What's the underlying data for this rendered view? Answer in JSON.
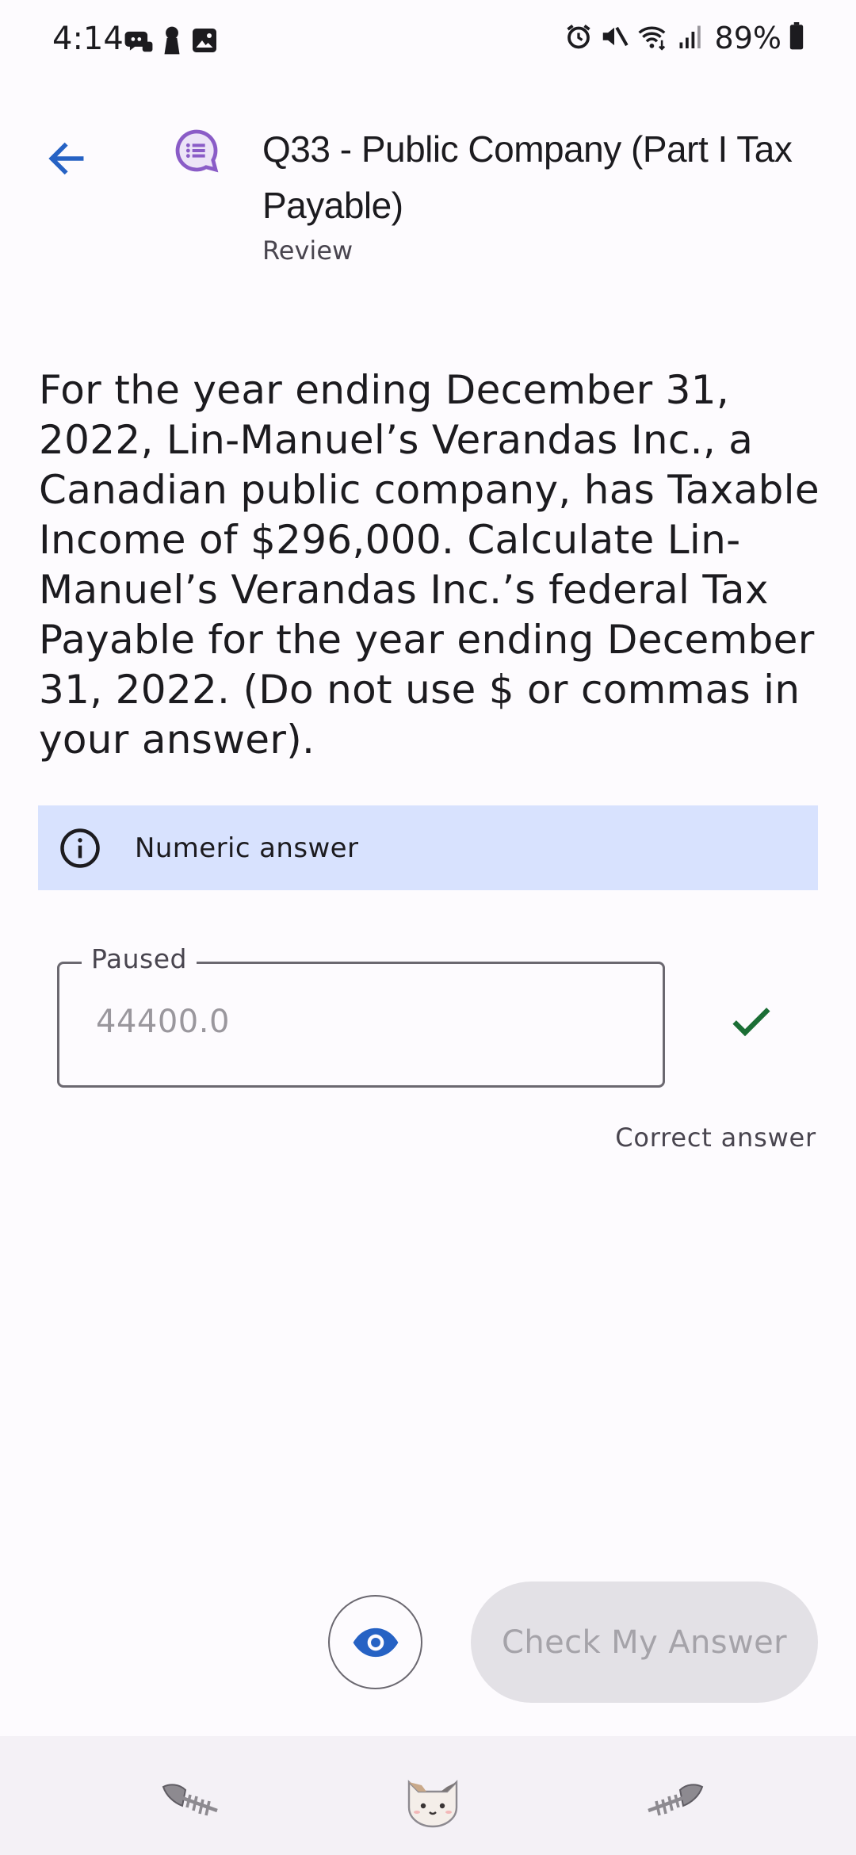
{
  "status_bar": {
    "time": "4:14",
    "battery": "89%",
    "left_icons": [
      "discord-icon",
      "keyhole-icon",
      "image-icon"
    ],
    "right_icons": [
      "alarm-icon",
      "mute-icon",
      "wifi-icon",
      "signal-icon",
      "battery-icon"
    ]
  },
  "header": {
    "title": "Q33 - Public Company (Part I Tax Payable)",
    "subtitle": "Review",
    "icon": "chat-list-icon",
    "accent": "#8a5cc7"
  },
  "question": {
    "text": "For the year ending December 31, 2022, Lin-Manuel’s Verandas Inc., a Canadian public company, has Taxable Income of $296,000. Calculate Lin-Manuel’s Verandas Inc.’s federal Tax Payable for the year ending December 31, 2022. (Do not use $ or commas in your answer)."
  },
  "info_banner": {
    "text": "Numeric answer",
    "icon": "info-icon",
    "background": "#d8e2fe"
  },
  "answer": {
    "label": "Paused",
    "placeholder": "44400.0",
    "status_text": "Correct answer",
    "status_color": "#1b6e35"
  },
  "actions": {
    "reveal_icon": "eye-icon",
    "check_label": "Check My Answer"
  },
  "bottom_nav": {
    "items": [
      "fishbone-left-icon",
      "cat-icon",
      "fishbone-right-icon"
    ]
  },
  "colors": {
    "primary_blue": "#2662c4",
    "background": "#fdfbfe"
  }
}
